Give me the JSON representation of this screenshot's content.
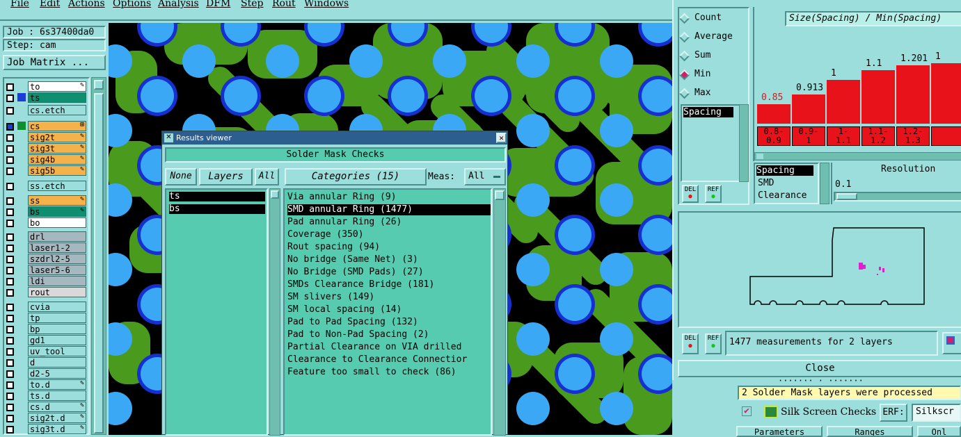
{
  "menu": [
    "File",
    "Edit",
    "Actions",
    "Options",
    "Analysis",
    "DFM",
    "Step",
    "Rout",
    "Windows"
  ],
  "left": {
    "job": "Job : 6s37400da0",
    "step": "Step: cam",
    "matrix_btn": "Job Matrix ...",
    "layers": [
      {
        "name": "to",
        "color": "#ffffff",
        "flag": "✎"
      },
      {
        "name": "ts",
        "color": "#0f8f6f",
        "flag": "",
        "sel": true
      },
      {
        "name": "cs.etch",
        "color": "#9bdedb",
        "flag": ""
      },
      {
        "name": "cs",
        "color": "#f5b24a",
        "flag": "⊞",
        "sel": true
      },
      {
        "name": "sig2t",
        "color": "#f5b24a",
        "flag": "✎"
      },
      {
        "name": "sig3t",
        "color": "#f5b24a",
        "flag": "✎"
      },
      {
        "name": "sig4b",
        "color": "#f5b24a",
        "flag": "✎"
      },
      {
        "name": "sig5b",
        "color": "#f5b24a",
        "flag": "✎"
      },
      {
        "name": "ss.etch",
        "color": "#9bdedb",
        "flag": ""
      },
      {
        "name": "ss",
        "color": "#f5b24a",
        "flag": "✎"
      },
      {
        "name": "bs",
        "color": "#0f8f6f",
        "flag": "✎"
      },
      {
        "name": "bo",
        "color": "#ffffff",
        "flag": ""
      },
      {
        "name": "drl",
        "color": "#a6b8bf",
        "flag": ""
      },
      {
        "name": "laser1-2",
        "color": "#a6b8bf",
        "flag": ""
      },
      {
        "name": "szdrl2-5",
        "color": "#a6b8bf",
        "flag": ""
      },
      {
        "name": "laser5-6",
        "color": "#a6b8bf",
        "flag": ""
      },
      {
        "name": "ldi",
        "color": "#a6b8bf",
        "flag": ""
      },
      {
        "name": "rout",
        "color": "#d9d9d9",
        "flag": ""
      },
      {
        "name": "cvia",
        "color": "#9bdedb",
        "flag": ""
      },
      {
        "name": "tp",
        "color": "#9bdedb",
        "flag": ""
      },
      {
        "name": "bp",
        "color": "#9bdedb",
        "flag": ""
      },
      {
        "name": "gd1",
        "color": "#9bdedb",
        "flag": ""
      },
      {
        "name": "uv_tool",
        "color": "#9bdedb",
        "flag": ""
      },
      {
        "name": "d",
        "color": "#9bdedb",
        "flag": ""
      },
      {
        "name": "d2-5",
        "color": "#9bdedb",
        "flag": ""
      },
      {
        "name": "to.d",
        "color": "#9bdedb",
        "flag": "✎"
      },
      {
        "name": "ts.d",
        "color": "#9bdedb",
        "flag": ""
      },
      {
        "name": "cs.d",
        "color": "#9bdedb",
        "flag": "✎"
      },
      {
        "name": "sig2t.d",
        "color": "#9bdedb",
        "flag": "✎"
      },
      {
        "name": "sig3t.d",
        "color": "#9bdedb",
        "flag": "✎"
      }
    ]
  },
  "results": {
    "title": "Results viewer",
    "header": "Solder Mask Checks",
    "none_btn": "None",
    "layers_btn": "Layers",
    "all_btn": "All",
    "categories_btn": "Categories (15)",
    "meas_label": "Meas:",
    "meas_value": "All",
    "layers_list": [
      "ts",
      "bs"
    ],
    "categories": [
      "Via annular Ring (9)",
      "SMD annular Ring (1477)",
      "Pad annular Ring (26)",
      "Coverage (350)",
      "Rout spacing (94)",
      "No bridge (Same Net) (3)",
      "No Bridge (SMD Pads) (27)",
      "SMDs Clearance Bridge (181)",
      "SM slivers (149)",
      "SM local spacing (14)",
      "Pad to Pad Spacing (132)",
      "Pad to Non-Pad Spacing (2)",
      "Partial Clearance on VIA drilled",
      "Clearance to Clearance Connectior",
      "Feature too small to check (86)"
    ],
    "selected_category": 1
  },
  "stats": {
    "modes": [
      "Count",
      "Average",
      "Sum",
      "Min",
      "Max"
    ],
    "active_mode": 3,
    "histogram_title": "Size(Spacing) / Min(Spacing)",
    "bar_values": [
      "0.85",
      "0.913",
      "1",
      "1.1",
      "1.201",
      "1"
    ],
    "bar_levels": [
      0.2,
      0.3,
      0.45,
      0.55,
      0.6,
      0.62
    ],
    "bin_labels": [
      [
        "0.8-",
        "0.9"
      ],
      [
        "0.9-",
        "1"
      ],
      [
        "1-",
        "1.1"
      ],
      [
        "1.1-",
        "1.2"
      ],
      [
        "1.2-",
        "1.3"
      ],
      [
        "",
        ""
      ]
    ],
    "spacing_list_top": [
      "Spacing"
    ],
    "spacing_list": [
      "Spacing",
      "SMD",
      "Clearance"
    ],
    "resolution_label": "Resolution",
    "resolution_value": "0.1",
    "del_label": "DEL",
    "ref_label": "REF",
    "measurement_text": "1477 measurements for 2 layers",
    "close_label": "Close"
  },
  "status": {
    "partial_row": "·······  ·  ·······",
    "message": "2 Solder Mask layers were processed",
    "silk_label": "Silk Screen Checks",
    "erf_label": "ERF:",
    "erf_value": "Silkscr",
    "bottom_tabs": [
      "Parameters",
      "Ranges",
      "Onl"
    ]
  }
}
